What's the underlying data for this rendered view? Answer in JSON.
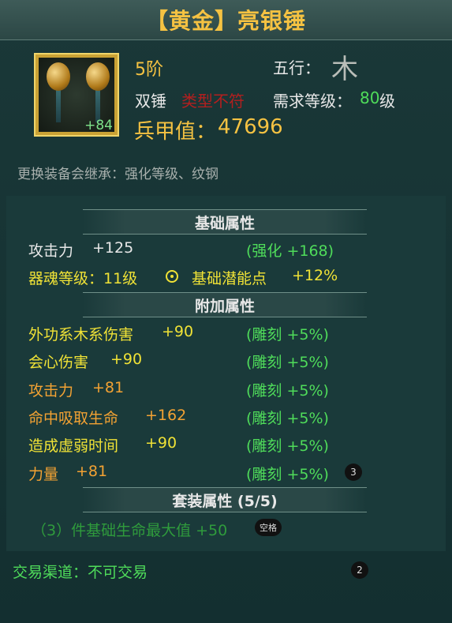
{
  "header": {
    "title": "【黄金】亮银锤"
  },
  "item": {
    "enhance_level": "+84",
    "tier": "5阶",
    "element_label": "五行：",
    "element_glyph": "木",
    "weapon_type": "双锤",
    "type_mismatch": "类型不符",
    "req_label": "需求等级：",
    "req_level": "80",
    "req_unit": "级",
    "power_label": "兵甲值：",
    "power_value": "47696",
    "inherit_note": "更换装备会继承：强化等级、纹钢"
  },
  "base": {
    "heading": "基础属性",
    "attack_label": "攻击力",
    "attack_value": "+125",
    "attack_bonus": "(强化 +168)",
    "soul_label": "器魂等级：11级",
    "potential_label": "基础潜能点",
    "potential_value": "+12%"
  },
  "extra": {
    "heading": "附加属性",
    "rows": [
      {
        "label": "外功系木系伤害",
        "value": "+90",
        "bonus": "(雕刻 +5%)",
        "color": "yellow"
      },
      {
        "label": "会心伤害",
        "value": "+90",
        "bonus": "(雕刻 +5%)",
        "color": "yellow"
      },
      {
        "label": "攻击力",
        "value": "+81",
        "bonus": "(雕刻 +5%)",
        "color": "orange"
      },
      {
        "label": "命中吸取生命",
        "value": "+162",
        "bonus": "(雕刻 +5%)",
        "color": "orange"
      },
      {
        "label": "造成虚弱时间",
        "value": "+90",
        "bonus": "(雕刻 +5%)",
        "color": "yellow"
      },
      {
        "label": "力量",
        "value": "+81",
        "bonus": "(雕刻 +5%)",
        "color": "orange"
      }
    ]
  },
  "set": {
    "heading": "套装属性 (5/5)",
    "bonus_line": "（3）件基础生命最大值 +50"
  },
  "trade": {
    "text": "交易渠道：不可交易"
  },
  "overlay": {
    "badge_a": "3",
    "tip": "空格",
    "badge_b": "2"
  },
  "colors": {
    "gold": "#f5c242",
    "green": "#4fdc5a",
    "yellow": "#f0e236",
    "orange": "#f3a233",
    "red": "#b21f1f"
  }
}
